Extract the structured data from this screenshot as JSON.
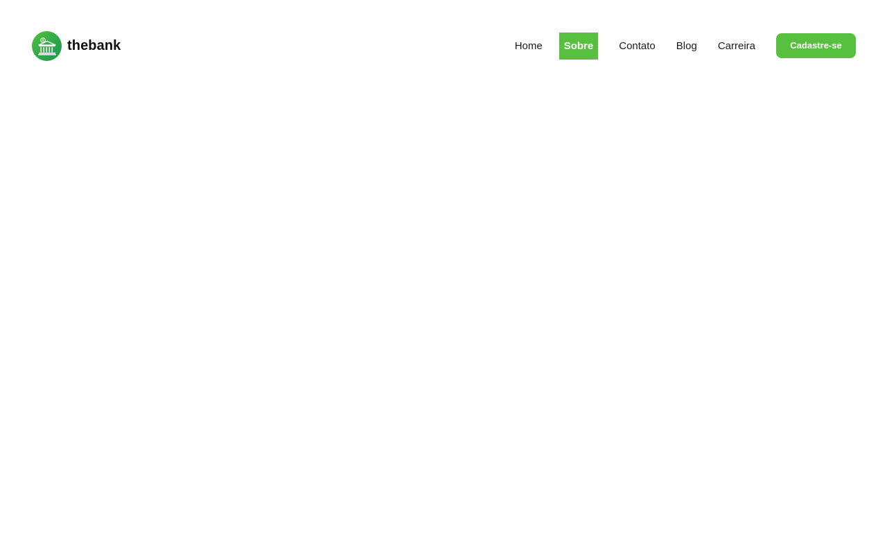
{
  "brand": {
    "name": "thebank",
    "logo_icon": "bank-building-icon",
    "logo_colors": [
      "#56c23b",
      "#1f9a52"
    ]
  },
  "nav": {
    "items": [
      {
        "label": "Home",
        "active": false
      },
      {
        "label": "Sobre",
        "active": true
      },
      {
        "label": "Contato",
        "active": false
      },
      {
        "label": "Blog",
        "active": false
      },
      {
        "label": "Carreira",
        "active": false
      }
    ],
    "cta_label": "Cadastre-se"
  },
  "colors": {
    "accent": "#57c03f",
    "text": "#1b1b1b",
    "background": "#ffffff"
  }
}
